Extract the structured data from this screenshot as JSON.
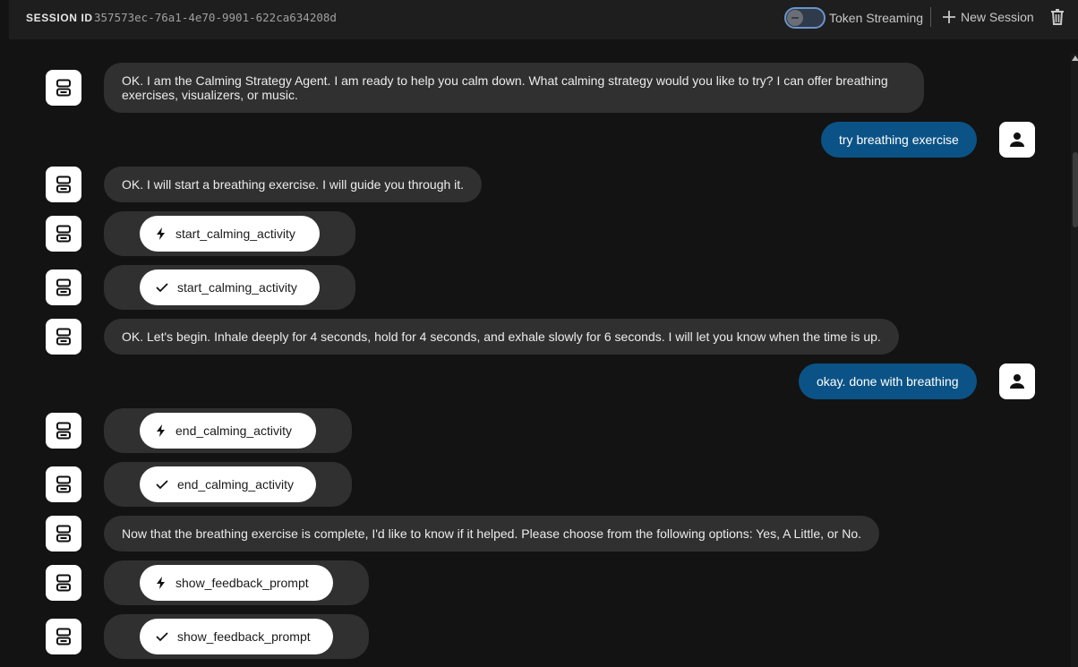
{
  "header": {
    "session_label": "SESSION ID",
    "session_id": "357573ec-76a1-4e70-9901-622ca634208d",
    "token_streaming_label": "Token Streaming",
    "token_streaming_on": false,
    "new_session_label": "New Session",
    "delete_icon": "trash-icon"
  },
  "messages": [
    {
      "role": "agent",
      "type": "text",
      "text": "OK. I am the Calming Strategy Agent. I am ready to help you calm down. What calming strategy would you like to try? I can offer breathing exercises, visualizers, or music."
    },
    {
      "role": "user",
      "type": "text",
      "text": "try breathing exercise"
    },
    {
      "role": "agent",
      "type": "text",
      "text": "OK. I will start a breathing exercise. I will guide you through it."
    },
    {
      "role": "agent",
      "type": "tool_call",
      "icon": "bolt-icon",
      "text": "start_calming_activity"
    },
    {
      "role": "agent",
      "type": "tool_result",
      "icon": "check-icon",
      "text": "start_calming_activity"
    },
    {
      "role": "agent",
      "type": "text",
      "text": "OK. Let's begin. Inhale deeply for 4 seconds, hold for 4 seconds, and exhale slowly for 6 seconds. I will let you know when the time is up."
    },
    {
      "role": "user",
      "type": "text",
      "text": "okay. done with breathing"
    },
    {
      "role": "agent",
      "type": "tool_call",
      "icon": "bolt-icon",
      "text": "end_calming_activity"
    },
    {
      "role": "agent",
      "type": "tool_result",
      "icon": "check-icon",
      "text": "end_calming_activity"
    },
    {
      "role": "agent",
      "type": "text",
      "text": "Now that the breathing exercise is complete, I'd like to know if it helped. Please choose from the following options: Yes, A Little, or No."
    },
    {
      "role": "agent",
      "type": "tool_call",
      "icon": "bolt-icon",
      "text": "show_feedback_prompt"
    },
    {
      "role": "agent",
      "type": "tool_result",
      "icon": "check-icon",
      "text": "show_feedback_prompt"
    }
  ],
  "colors": {
    "background": "#131313",
    "header": "#1e1e1e",
    "agent_bubble": "#303030",
    "user_bubble": "#0b5386",
    "toggle_border": "#6c94c9"
  }
}
